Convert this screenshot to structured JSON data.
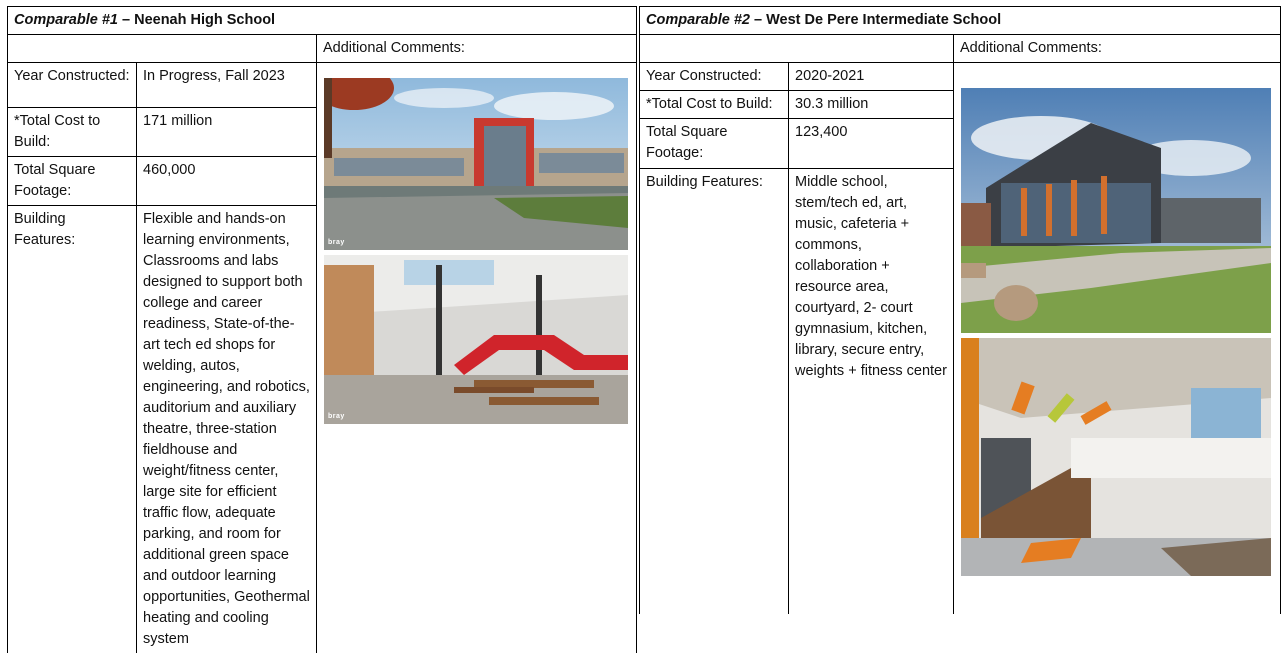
{
  "comparable1": {
    "label": "Comparable #1",
    "dash": " – ",
    "name": "Neenah High School",
    "comments_label": "Additional Comments:",
    "rows": [
      {
        "label": "Year Constructed:",
        "value": "In Progress, Fall 2023"
      },
      {
        "label": "*Total Cost to Build:",
        "value": "171 million"
      },
      {
        "label": "Total Square Footage:",
        "value": "460,000"
      },
      {
        "label": "Building Features:",
        "value": "Flexible and hands-on learning environments, Classrooms and labs designed to support both college and career readiness, State-of-the-art tech ed shops for welding, autos, engineering, and robotics, auditorium and auxiliary theatre, three-station fieldhouse and weight/fitness center, large site for efficient traffic flow, adequate parking, and room for additional green space and outdoor learning opportunities, Geothermal heating and cooling system"
      }
    ],
    "photo_logo": "bray"
  },
  "comparable2": {
    "label": "Comparable #2",
    "dash": " – ",
    "name": "West De Pere Intermediate School",
    "comments_label": "Additional Comments:",
    "rows": [
      {
        "label": "Year Constructed:",
        "value": "2020-2021"
      },
      {
        "label": "*Total Cost to Build:",
        "value": "30.3 million"
      },
      {
        "label": "Total Square Footage:",
        "value": "123,400"
      },
      {
        "label": "Building Features:",
        "value": "Middle school, stem/tech ed, art, music, cafeteria + commons, collaboration + resource area, courtyard, 2- court gymnasium, kitchen, library, secure entry, weights + fitness center"
      }
    ]
  }
}
